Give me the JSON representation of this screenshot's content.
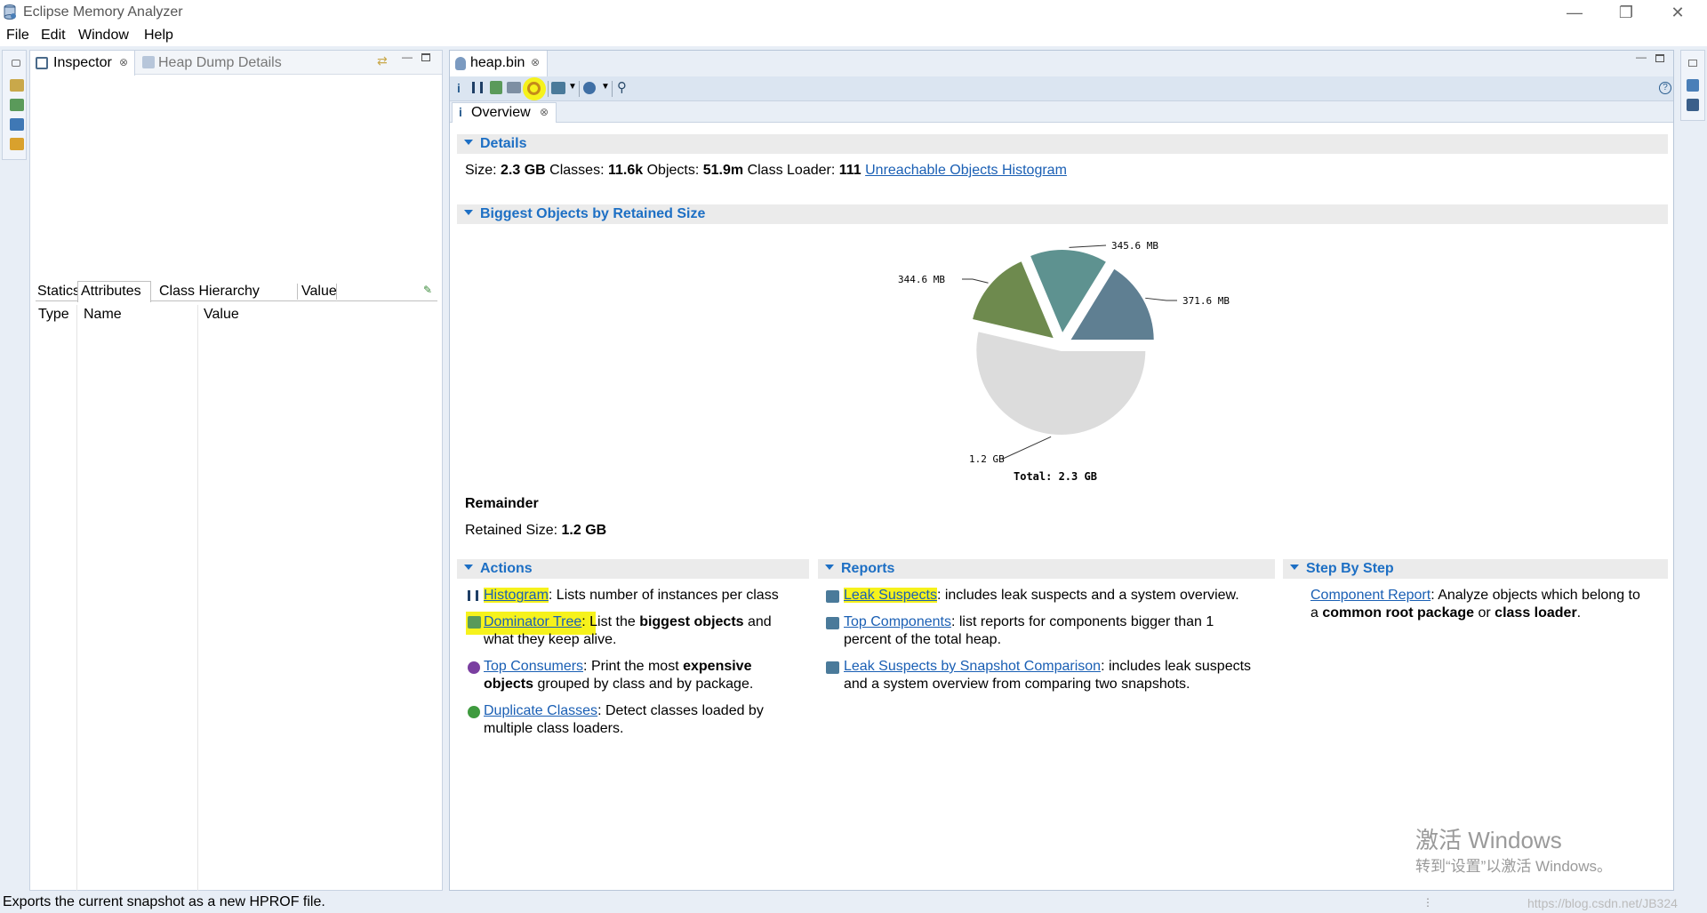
{
  "window": {
    "title": "Eclipse Memory Analyzer"
  },
  "menu": [
    "File",
    "Edit",
    "Window",
    "Help"
  ],
  "left_panel": {
    "tabs": [
      {
        "label": "Inspector",
        "active": true
      },
      {
        "label": "Heap Dump Details",
        "active": false
      }
    ],
    "sub_tabs": [
      "Statics",
      "Attributes",
      "Class Hierarchy",
      "Value"
    ],
    "table_headers": [
      "Type",
      "Name",
      "Value"
    ]
  },
  "editor": {
    "tab_label": "heap.bin",
    "overview_tab": "Overview"
  },
  "details": {
    "heading": "Details",
    "size_label": "Size:",
    "size_value": "2.3 GB",
    "classes_label": "Classes:",
    "classes_value": "11.6k",
    "objects_label": "Objects:",
    "objects_value": "51.9m",
    "loader_label": "Class Loader:",
    "loader_value": "111",
    "unreachable_link": "Unreachable Objects Histogram"
  },
  "biggest": {
    "heading": "Biggest Objects by Retained Size",
    "remainder_title": "Remainder",
    "retained_label": "Retained Size:",
    "retained_value": "1.2 GB"
  },
  "chart_data": {
    "type": "pie",
    "title": "",
    "total_label": "Total: 2.3 GB",
    "slices": [
      {
        "label": "371.6 MB",
        "value": 371.6,
        "color": "#5f7f92"
      },
      {
        "label": "345.6 MB",
        "value": 345.6,
        "color": "#5e9290"
      },
      {
        "label": "344.6 MB",
        "value": 344.6,
        "color": "#6e8a4e"
      },
      {
        "label": "1.2 GB",
        "value": 1228.8,
        "color": "#dcdcdc"
      }
    ]
  },
  "actions": {
    "heading": "Actions",
    "items": [
      {
        "link": "Histogram",
        "text": ": Lists number of instances per class"
      },
      {
        "link": "Dominator Tree",
        "text_a": ": List the ",
        "bold": "biggest objects",
        "text_b": " and",
        "line2": "what they keep alive."
      },
      {
        "link": "Top Consumers",
        "text_a": ": Print the most ",
        "bold": "expensive",
        "line2_bold": "objects",
        "line2": " grouped by class and by package."
      },
      {
        "link": "Duplicate Classes",
        "text": ": Detect classes loaded by",
        "line2": "multiple class loaders."
      }
    ]
  },
  "reports": {
    "heading": "Reports",
    "items": [
      {
        "link": "Leak Suspects",
        "text": ": includes leak suspects and a system overview."
      },
      {
        "link": "Top Components",
        "text": ": list reports for components bigger than 1",
        "line2": "percent of the total heap."
      },
      {
        "link": "Leak Suspects by Snapshot Comparison",
        "text": ": includes leak suspects",
        "line2": "and a system overview from comparing two snapshots."
      }
    ]
  },
  "step_by_step": {
    "heading": "Step By Step",
    "link": "Component Report",
    "text": ": Analyze objects which belong to",
    "line2_a": "a ",
    "bold_a": "common root package",
    "line2_b": " or ",
    "bold_b": "class loader",
    "line2_c": "."
  },
  "watermark": {
    "line1": "激活 Windows",
    "line2": "转到“设置”以激活 Windows。",
    "url": "https://blog.csdn.net/JB324"
  },
  "status_bar": "Exports the current snapshot as a new HPROF file.",
  "colors": {
    "section_bg": "#ebebeb",
    "section_fg": "#1d6fc4",
    "link": "#1a5fb4",
    "highlight": "#f6f21c",
    "frame_bg": "#e8eef6"
  }
}
